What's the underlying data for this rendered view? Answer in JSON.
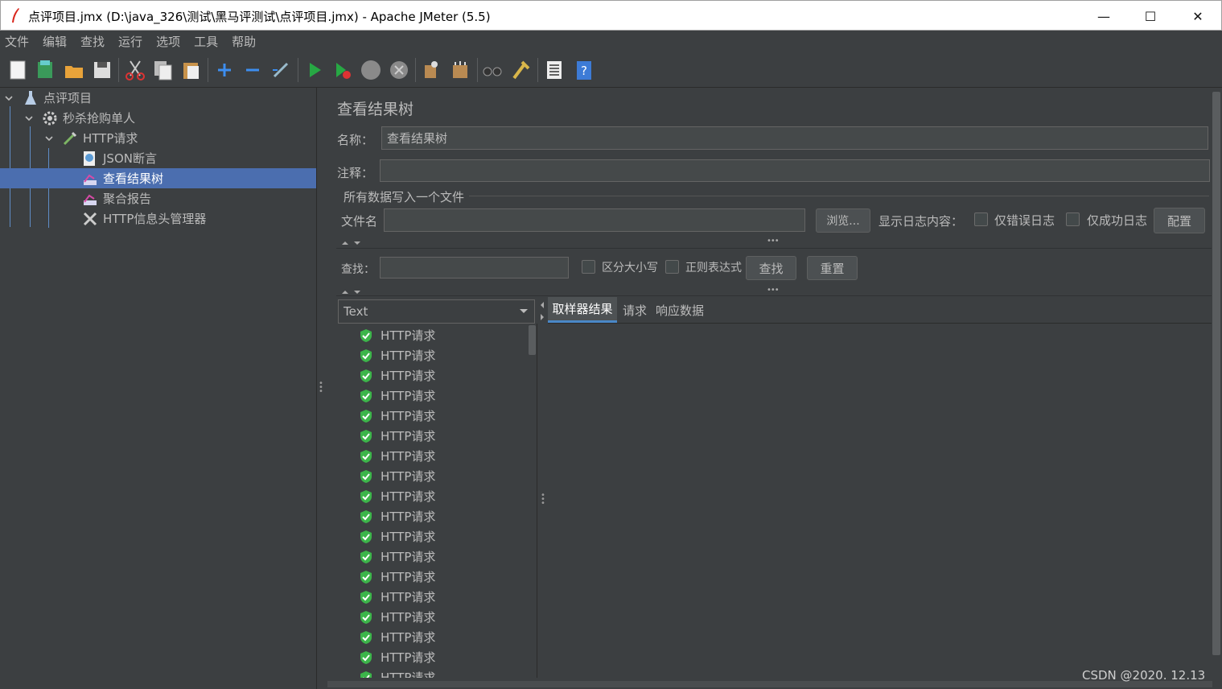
{
  "window": {
    "title": "点评项目.jmx (D:\\java_326\\测试\\黑马评测试\\点评项目.jmx) - Apache JMeter (5.5)",
    "minimize": "—",
    "maximize": "☐",
    "close": "✕"
  },
  "menu": [
    "文件",
    "编辑",
    "查找",
    "运行",
    "选项",
    "工具",
    "帮助"
  ],
  "toolbar_icons": [
    "new-icon",
    "templates-icon",
    "open-icon",
    "save-icon",
    "cut-icon",
    "copy-icon",
    "paste-icon",
    "expand-icon",
    "collapse-icon",
    "toggle-icon",
    "start-icon",
    "start-no-pause-icon",
    "stop-icon",
    "shutdown-icon",
    "clear-icon",
    "clear-all-icon",
    "search-icon",
    "reset-search-icon",
    "function-helper-icon",
    "help-icon"
  ],
  "tree": {
    "root": "点评项目",
    "thread_group": "秒杀抢购单人",
    "sampler": "HTTP请求",
    "children": [
      "JSON断言",
      "查看结果树",
      "聚合报告",
      "HTTP信息头管理器"
    ]
  },
  "panel": {
    "title": "查看结果树",
    "name_label": "名称：",
    "name_value": "查看结果树",
    "comment_label": "注释：",
    "comment_value": "",
    "file_section": "所有数据写入一个文件",
    "filename_label": "文件名",
    "filename_value": "",
    "browse": "浏览...",
    "log_label": "显示日志内容：",
    "errors_only": "仅错误日志",
    "success_only": "仅成功日志",
    "configure": "配置",
    "search_label": "查找：",
    "search_value": "",
    "case_sensitive": "区分大小写",
    "regex": "正则表达式",
    "find_button": "查找",
    "reset_button": "重置",
    "renderer": "Text",
    "tabs": [
      "取样器结果",
      "请求",
      "响应数据"
    ]
  },
  "results": [
    "HTTP请求",
    "HTTP请求",
    "HTTP请求",
    "HTTP请求",
    "HTTP请求",
    "HTTP请求",
    "HTTP请求",
    "HTTP请求",
    "HTTP请求",
    "HTTP请求",
    "HTTP请求",
    "HTTP请求",
    "HTTP请求",
    "HTTP请求",
    "HTTP请求",
    "HTTP请求",
    "HTTP请求",
    "HTTP请求"
  ],
  "watermark": "CSDN @2020. 12.13",
  "colors": {
    "background": "#3c3f41",
    "selection": "#4b6eaf",
    "success": "#3cb54a",
    "start": "#27a844"
  }
}
